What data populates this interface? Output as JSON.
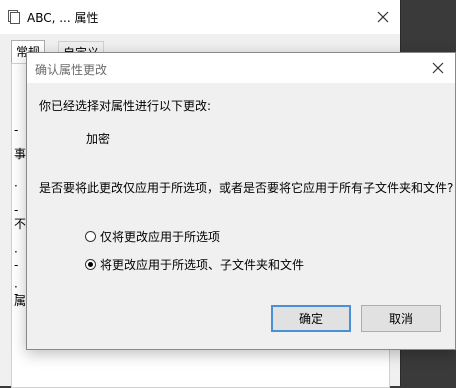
{
  "background_window": {
    "title": "ABC, ... 属性",
    "tabs": [
      "常规",
      "自定义"
    ],
    "side_glyphs": [
      "-",
      "事",
      "·",
      "-",
      "不",
      "·",
      "-",
      "·",
      "-",
      "属"
    ]
  },
  "dialog": {
    "title": "确认属性更改",
    "intro": "你已经选择对属性进行以下更改:",
    "change": "加密",
    "question": "是否要将此更改仅应用于所选项，或者是否要将它应用于所有子文件夹和文件?",
    "options": [
      {
        "label": "仅将更改应用于所选项",
        "checked": false
      },
      {
        "label": "将更改应用于所选项、子文件夹和文件",
        "checked": true
      }
    ],
    "ok_label": "确定",
    "cancel_label": "取消"
  },
  "colors": {
    "default_button_border": "#4a90d9",
    "dialog_title": "#6b6b6b"
  }
}
